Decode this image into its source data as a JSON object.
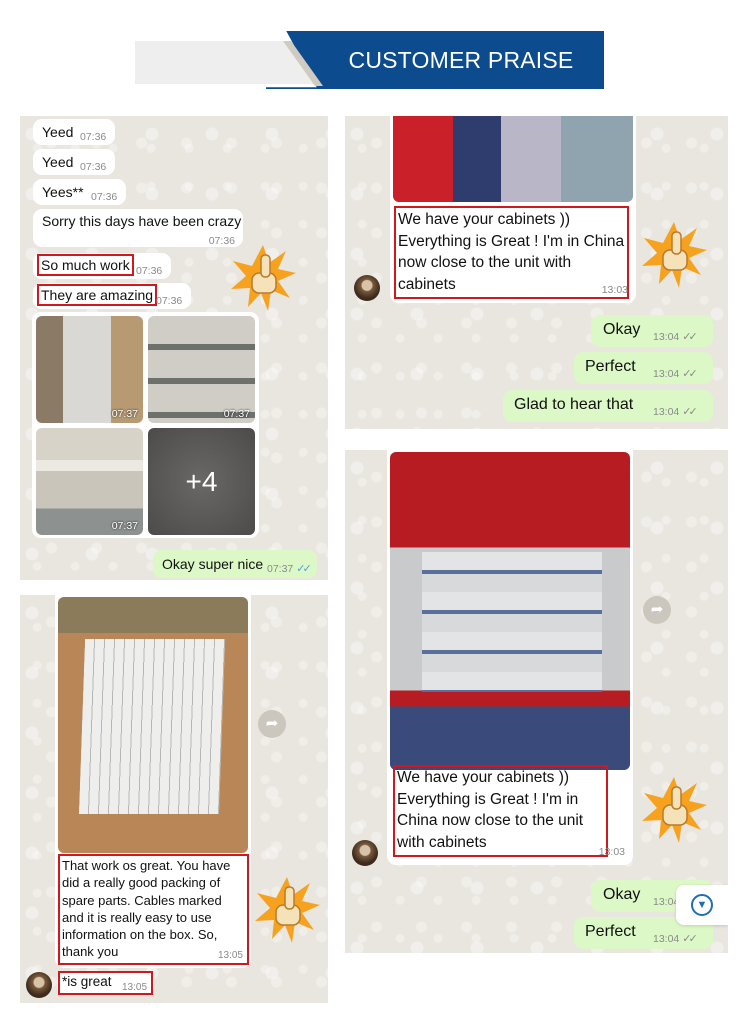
{
  "header": {
    "title": "CUSTOMER PRAISE"
  },
  "colors": {
    "banner_blue": "#0b4b8e",
    "highlight_red": "#d0191f",
    "outgoing_bubble": "#dcf8c6",
    "read_ticks": "#4fa3e0"
  },
  "chat1": {
    "messages": [
      {
        "text": "Yeed",
        "time": "07:36"
      },
      {
        "text": "Yeed",
        "time": "07:36"
      },
      {
        "text": "Yees**",
        "time": "07:36"
      },
      {
        "text": "Sorry this days have been crazy",
        "time": "07:36"
      },
      {
        "text": "So much work",
        "time": "07:36",
        "highlighted": true
      },
      {
        "text": "They are amazing",
        "time": "07:36",
        "highlighted": true
      }
    ],
    "photos": [
      {
        "time": "07:37",
        "subject": "wrapped cabinet"
      },
      {
        "time": "07:37",
        "subject": "cabinet shelves"
      },
      {
        "time": "07:37",
        "subject": "cabinet interior"
      },
      {
        "more_count": "+4"
      }
    ],
    "reply": {
      "text": "Okay super nice",
      "time": "07:37",
      "ticks": "read"
    }
  },
  "chat2": {
    "incoming": {
      "text": "We have your cabinets )) Everything is Great ! I'm in China now close to the unit with cabinets",
      "time": "13:03",
      "highlighted": true
    },
    "replies": [
      {
        "text": "Okay",
        "time": "13:04",
        "ticks": "delivered"
      },
      {
        "text": "Perfect",
        "time": "13:04",
        "ticks": "delivered"
      },
      {
        "text": "Glad to hear that",
        "time": "13:04",
        "ticks": "delivered"
      }
    ]
  },
  "chat3": {
    "photo_subject": "packing list on wooden crate",
    "message": {
      "text": "That work os great. You have did a really good packing of spare parts. Cables marked and it is really easy to use information on the box. So, thank you",
      "time": "13:05",
      "highlighted": true
    },
    "correction": {
      "text": "*is great",
      "time": "13:05",
      "highlighted": true
    }
  },
  "chat4": {
    "photo_subject": "open red electrical control cabinet",
    "incoming": {
      "text": "We have your cabinets )) Everything is Great ! I'm in China now close to the unit with cabinets",
      "time": "13:03",
      "highlighted": true
    },
    "replies": [
      {
        "text": "Okay",
        "time": "13:04",
        "ticks": "delivered"
      },
      {
        "text": "Perfect",
        "time": "13:04",
        "ticks": "delivered"
      }
    ]
  },
  "icons": {
    "thumbs_up": "thumbs-up-sticker",
    "forward": "forward-arrow",
    "scroll_down": "chevron-down-circle",
    "ticks": "✓✓"
  }
}
